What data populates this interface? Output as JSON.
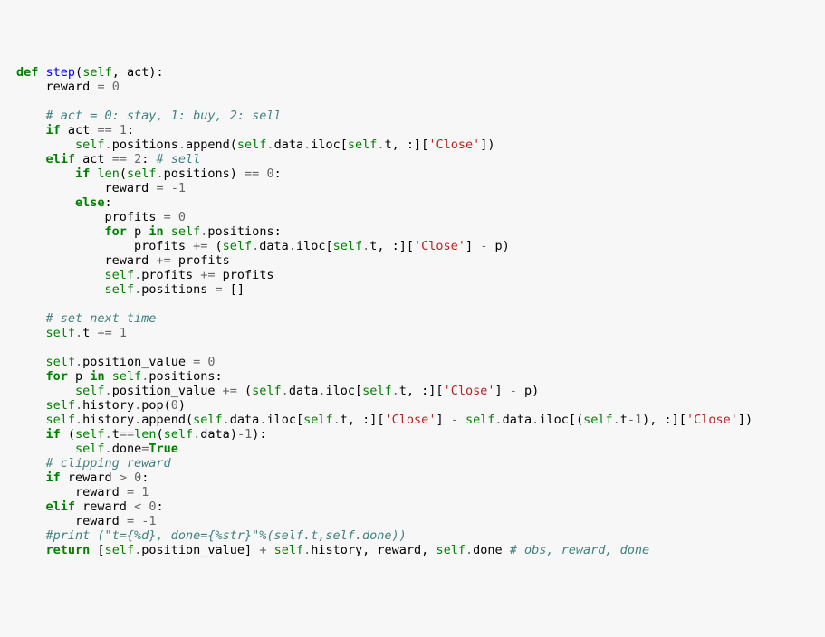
{
  "code": {
    "w_def": "def",
    "w_step": "step",
    "w_self": "self",
    "w_act": "act",
    "w_reward": "reward",
    "eq": "=",
    "n0": "0",
    "n1": "1",
    "n2": "2",
    "nm1": "-",
    "c_actmap": "# act = 0: stay, 1: buy, 2: sell",
    "w_if": "if",
    "w_elif": "elif",
    "w_else": "else",
    "eqeq": "==",
    "w_positions": "positions",
    "w_append": "append",
    "w_data": "data",
    "w_iloc": "iloc",
    "w_t": "t",
    "str_close": "'Close'",
    "c_sell": "# sell",
    "w_len": "len",
    "w_profits": "profits",
    "w_for": "for",
    "w_p": "p",
    "w_in": "in",
    "pluseq": "+=",
    "minus": "-",
    "plus": "+",
    "gt": ">",
    "lt": "<",
    "c_nexttime": "# set next time",
    "w_posval": "position_value",
    "w_history": "history",
    "w_pop": "pop",
    "w_done": "done",
    "w_true": "True",
    "c_clip": "# clipping reward",
    "c_print": "#print (\"t={%d}, done={%str}\"%(self.t,self.done))",
    "w_return": "return",
    "c_obs": "# obs, reward, done"
  }
}
